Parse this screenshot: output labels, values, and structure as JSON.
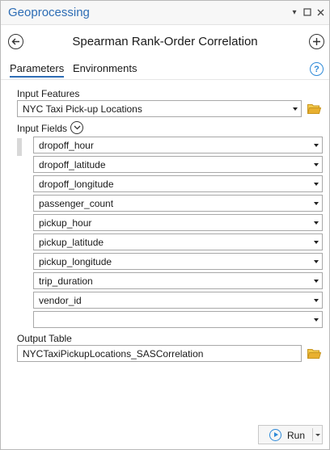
{
  "pane": {
    "title": "Geoprocessing",
    "controls": [
      "pin-icon",
      "maximize-icon",
      "close-icon"
    ]
  },
  "tool": {
    "title": "Spearman Rank-Order Correlation"
  },
  "tabs": [
    {
      "label": "Parameters",
      "active": true
    },
    {
      "label": "Environments",
      "active": false
    }
  ],
  "params": {
    "input_features": {
      "label": "Input Features",
      "value": "NYC Taxi Pick-up Locations"
    },
    "input_fields": {
      "label": "Input Fields",
      "items": [
        "dropoff_hour",
        "dropoff_latitude",
        "dropoff_longitude",
        "passenger_count",
        "pickup_hour",
        "pickup_latitude",
        "pickup_longitude",
        "trip_duration",
        "vendor_id",
        ""
      ]
    },
    "output_table": {
      "label": "Output Table",
      "value": "NYCTaxiPickupLocations_SASCorrelation"
    }
  },
  "run": {
    "label": "Run"
  },
  "colors": {
    "accent": "#2d6db5",
    "help": "#2f8ad8",
    "folder": "#e8b030"
  }
}
